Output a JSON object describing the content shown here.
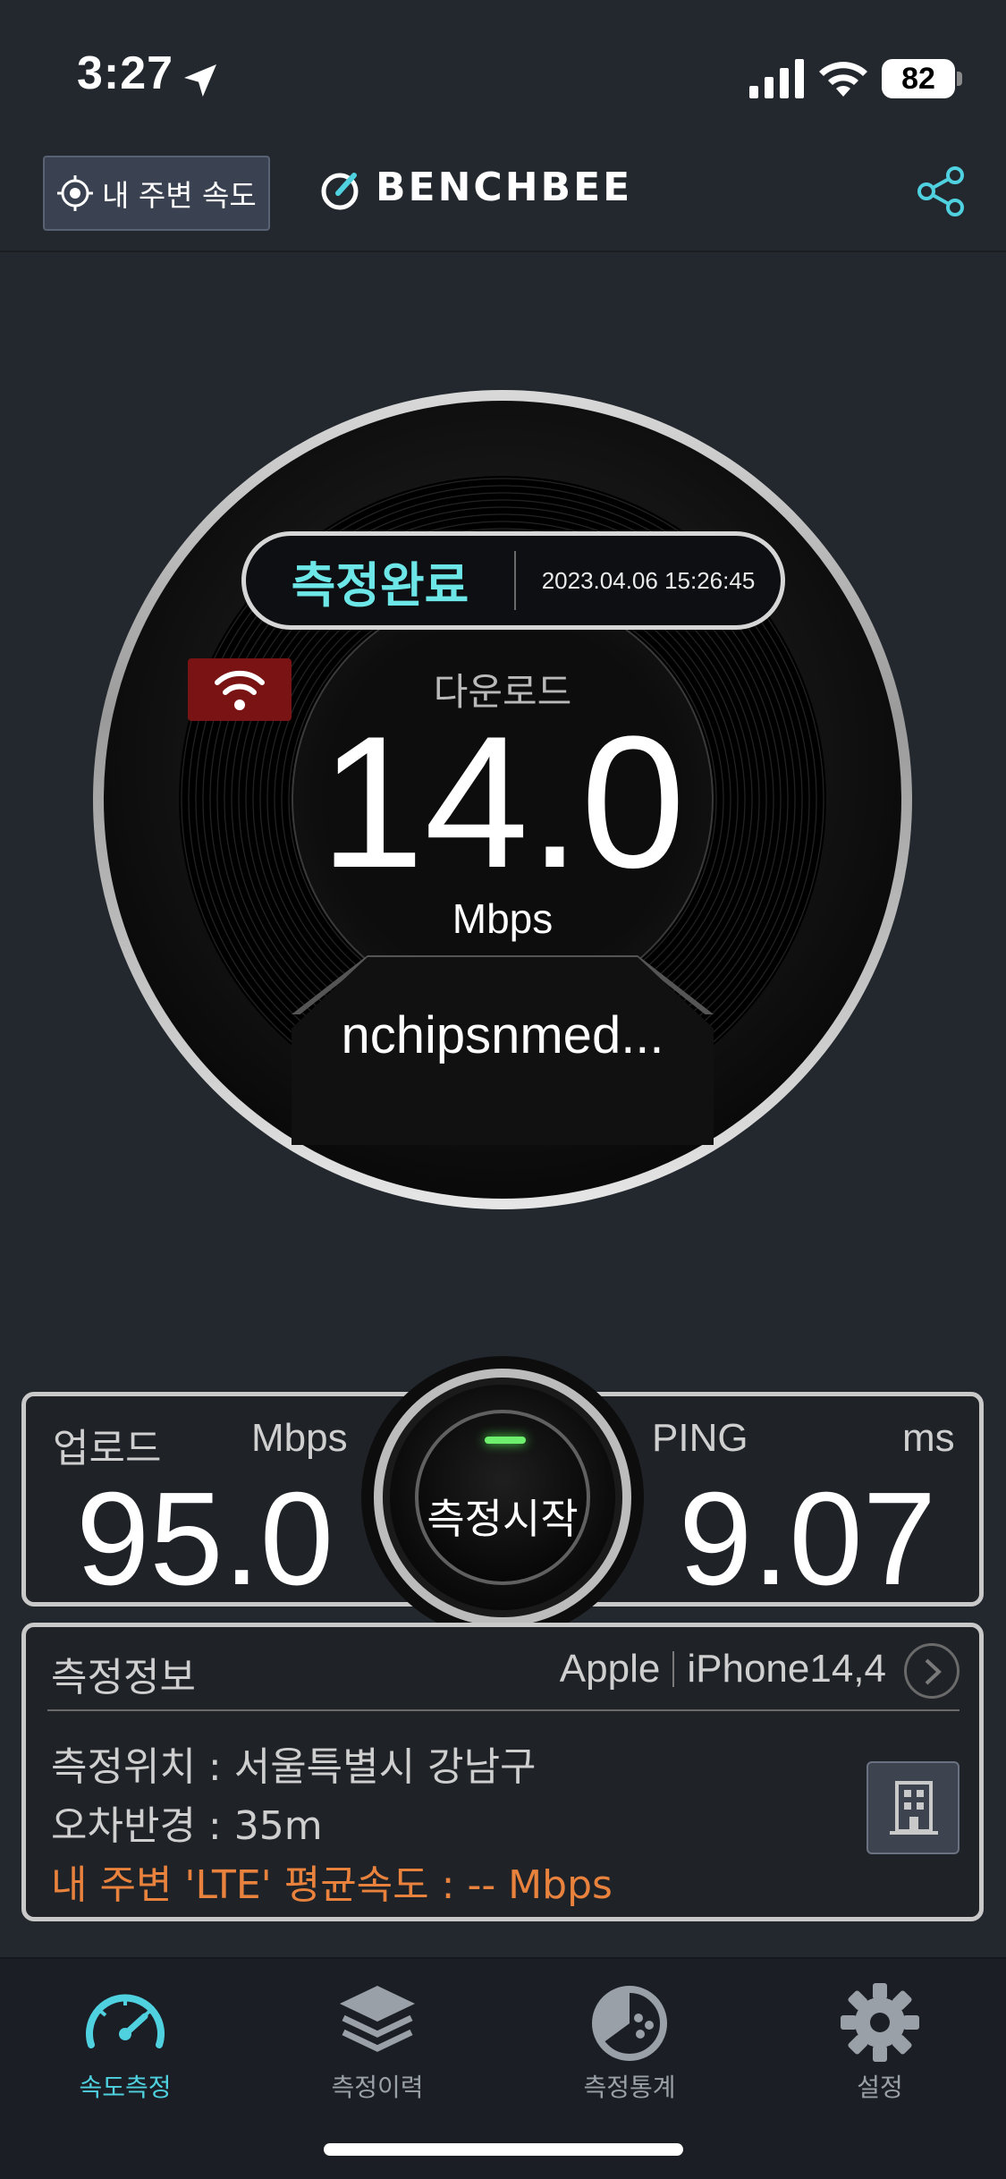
{
  "status_bar": {
    "time": "3:27",
    "battery": "82"
  },
  "header": {
    "nearby_label": "내 주변 속도",
    "brand": "BENCHBEE"
  },
  "gauge": {
    "status_label": "측정완료",
    "datetime": "2023.04.06 15:26:45",
    "download_label": "다운로드",
    "download_value": "14.0",
    "download_unit": "Mbps",
    "network_name": "nchipsnmed..."
  },
  "metrics": {
    "upload_label": "업로드",
    "upload_unit": "Mbps",
    "upload_value": "95.0",
    "ping_label": "PING",
    "ping_unit": "ms",
    "ping_value": "9.07",
    "start_label": "측정시작"
  },
  "info": {
    "title": "측정정보",
    "device_brand": "Apple",
    "device_model": "iPhone14,4",
    "location": "측정위치 : 서울특별시 강남구",
    "error_radius": "오차반경 : 35m",
    "nearby_average": "내 주변 'LTE' 평균속도 : -- Mbps"
  },
  "tabs": [
    {
      "label": "속도측정",
      "icon": "speedometer-icon",
      "active": true
    },
    {
      "label": "측정이력",
      "icon": "layers-icon",
      "active": false
    },
    {
      "label": "측정통계",
      "icon": "stats-icon",
      "active": false
    },
    {
      "label": "설정",
      "icon": "gear-icon",
      "active": false
    }
  ],
  "colors": {
    "accent": "#4fd1e0",
    "alert": "#e9823d",
    "background": "#23282e",
    "wifi_badge": "#7a1414"
  }
}
